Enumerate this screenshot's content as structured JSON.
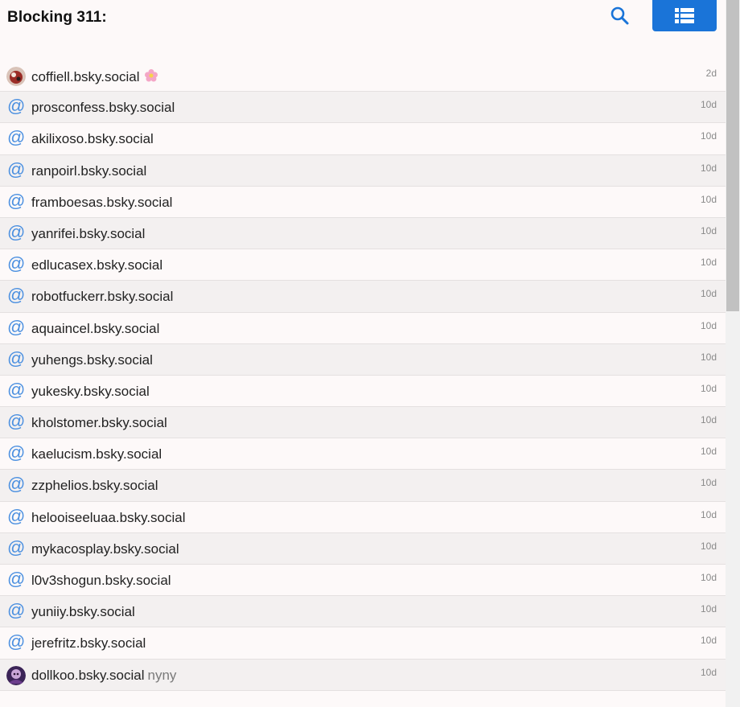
{
  "header": {
    "title": "Blocking 311:"
  },
  "colors": {
    "accent": "#1a74d8",
    "at_symbol": "#4a8fe0",
    "row_odd": "#fdf9f9",
    "row_even": "#f3f0f0"
  },
  "rows": [
    {
      "icon": "avatar",
      "handle": "coffiell.bsky.social",
      "extra": "",
      "emoji": "flower-icon",
      "time": "2d"
    },
    {
      "icon": "at",
      "handle": "prosconfess.bsky.social",
      "extra": "",
      "time": "10d"
    },
    {
      "icon": "at",
      "handle": "akilixoso.bsky.social",
      "extra": "",
      "time": "10d"
    },
    {
      "icon": "at",
      "handle": "ranpoirl.bsky.social",
      "extra": "",
      "time": "10d"
    },
    {
      "icon": "at",
      "handle": "framboesas.bsky.social",
      "extra": "",
      "time": "10d"
    },
    {
      "icon": "at",
      "handle": "yanrifei.bsky.social",
      "extra": "",
      "time": "10d"
    },
    {
      "icon": "at",
      "handle": "edlucasex.bsky.social",
      "extra": "",
      "time": "10d"
    },
    {
      "icon": "at",
      "handle": "robotfuckerr.bsky.social",
      "extra": "",
      "time": "10d"
    },
    {
      "icon": "at",
      "handle": "aquaincel.bsky.social",
      "extra": "",
      "time": "10d"
    },
    {
      "icon": "at",
      "handle": "yuhengs.bsky.social",
      "extra": "",
      "time": "10d"
    },
    {
      "icon": "at",
      "handle": "yukesky.bsky.social",
      "extra": "",
      "time": "10d"
    },
    {
      "icon": "at",
      "handle": "kholstomer.bsky.social",
      "extra": "",
      "time": "10d"
    },
    {
      "icon": "at",
      "handle": "kaelucism.bsky.social",
      "extra": "",
      "time": "10d"
    },
    {
      "icon": "at",
      "handle": "zzphelios.bsky.social",
      "extra": "",
      "time": "10d"
    },
    {
      "icon": "at",
      "handle": "helooiseeluaa.bsky.social",
      "extra": "",
      "time": "10d"
    },
    {
      "icon": "at",
      "handle": "mykacosplay.bsky.social",
      "extra": "",
      "time": "10d"
    },
    {
      "icon": "at",
      "handle": "l0v3shogun.bsky.social",
      "extra": "",
      "time": "10d"
    },
    {
      "icon": "at",
      "handle": "yuniiy.bsky.social",
      "extra": "",
      "time": "10d"
    },
    {
      "icon": "at",
      "handle": "jerefritz.bsky.social",
      "extra": "",
      "time": "10d"
    },
    {
      "icon": "avatar",
      "handle": "dollkoo.bsky.social",
      "extra": "nyny",
      "time": "10d"
    }
  ]
}
